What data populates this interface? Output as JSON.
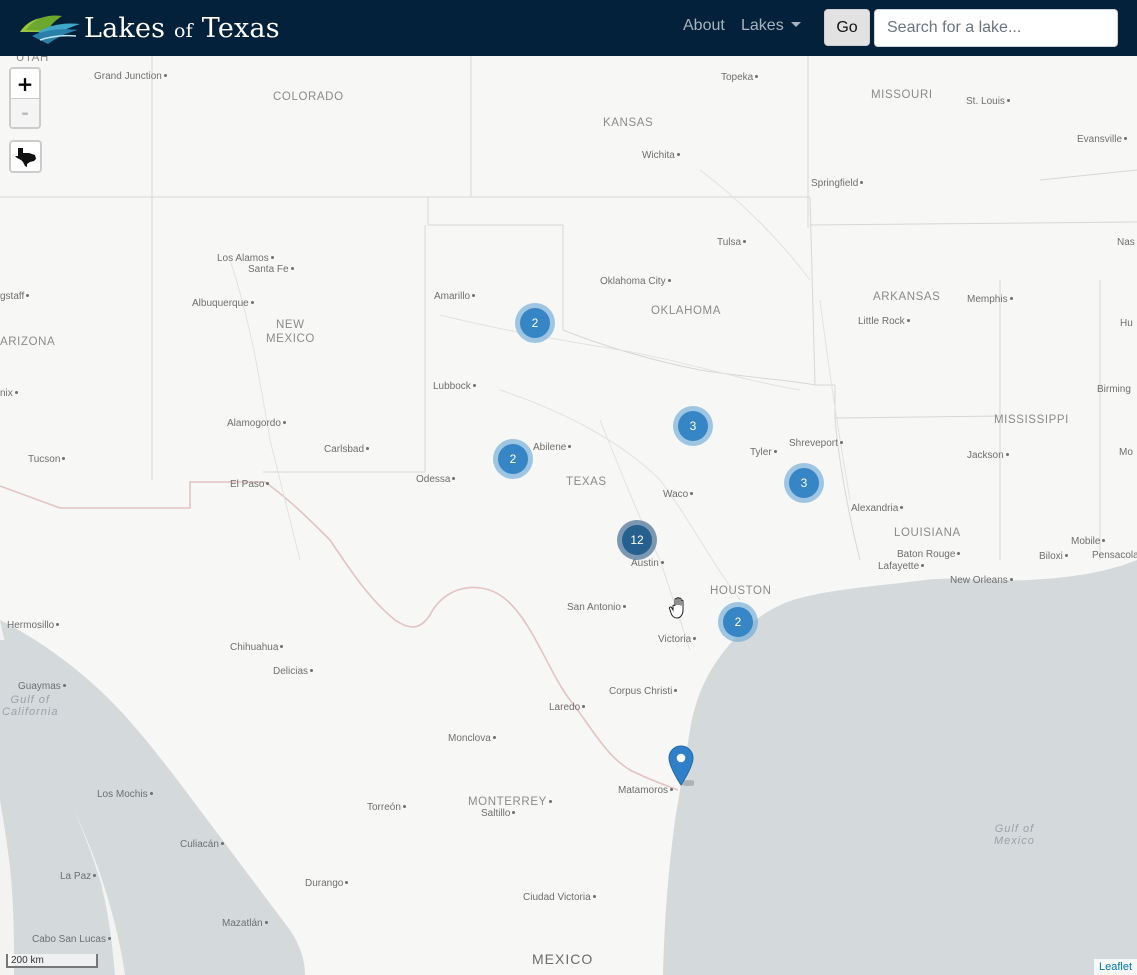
{
  "navbar": {
    "brand_main": "Lakes",
    "brand_of": "of",
    "brand_end": "Texas",
    "about_label": "About",
    "lakes_label": "Lakes",
    "go_label": "Go",
    "search_placeholder": "Search for a lake..."
  },
  "map": {
    "zoom_in": "+",
    "zoom_out": "-",
    "scale_label": "200 km",
    "attribution": "Leaflet",
    "clusters": [
      "2",
      "3",
      "2",
      "3",
      "12",
      "2"
    ],
    "labels": {
      "utah": "UTAH",
      "colorado": "COLORADO",
      "kansas": "KANSAS",
      "missouri": "MISSOURI",
      "new_mexico_1": "NEW",
      "new_mexico_2": "MEXICO",
      "oklahoma": "OKLAHOMA",
      "arkansas": "ARKANSAS",
      "arizona": "ARIZONA",
      "mississippi": "MISSISSIPPI",
      "texas": "TEXAS",
      "louisiana": "LOUISIANA",
      "houston": "HOUSTON",
      "monterrey": "MONTERREY",
      "mexico": "MEXICO",
      "gulf_ca_1": "Gulf of",
      "gulf_ca_2": "California",
      "gulf_mx_1": "Gulf of",
      "gulf_mx_2": "Mexico"
    },
    "cities": {
      "grand_junction": "Grand Junction",
      "topeka": "Topeka",
      "st_louis": "St. Louis",
      "wichita": "Wichita",
      "evansville": "Evansville",
      "springfield": "Springfield",
      "tulsa": "Tulsa",
      "nas": "Nas",
      "los_alamos": "Los Alamos",
      "santa_fe": "Santa Fe",
      "oklahoma_city": "Oklahoma City",
      "amarillo": "Amarillo",
      "gstaff": "gstaff",
      "albuquerque": "Albuquerque",
      "memphis": "Memphis",
      "little_rock": "Little Rock",
      "hu": "Hu",
      "lubbock": "Lubbock",
      "nix": "nix",
      "birming": "Birming",
      "alamogordo": "Alamogordo",
      "abilene": "Abilene",
      "shreveport": "Shreveport",
      "carlsbad": "Carlsbad",
      "tyler": "Tyler",
      "tucson": "Tucson",
      "jackson": "Jackson",
      "mo": "Mo",
      "odessa": "Odessa",
      "el_paso": "El Paso",
      "waco": "Waco",
      "alexandria": "Alexandria",
      "austin": "Austin",
      "mobile": "Mobile",
      "baton_rouge": "Baton Rouge",
      "lafayette": "Lafayette",
      "biloxi": "Biloxi",
      "pensacola": "Pensacola",
      "new_orleans": "New Orleans",
      "san_antonio": "San Antonio",
      "hermosillo": "Hermosillo",
      "victoria": "Victoria",
      "chihuahua": "Chihuahua",
      "delicias": "Delicias",
      "guaymas": "Guaymas",
      "corpus_christi": "Corpus Christi",
      "laredo": "Laredo",
      "monclova": "Monclova",
      "matamoros": "Matamoros",
      "los_mochis": "Los Mochis",
      "torreon": "Torreón",
      "saltillo": "Saltillo",
      "culiacan": "Culiacán",
      "la_paz": "La Paz",
      "durango": "Durango",
      "ciudad_victoria": "Ciudad Victoria",
      "mazatlan": "Mazatlán",
      "cabo_san_lucas": "Cabo San Lucas"
    }
  }
}
